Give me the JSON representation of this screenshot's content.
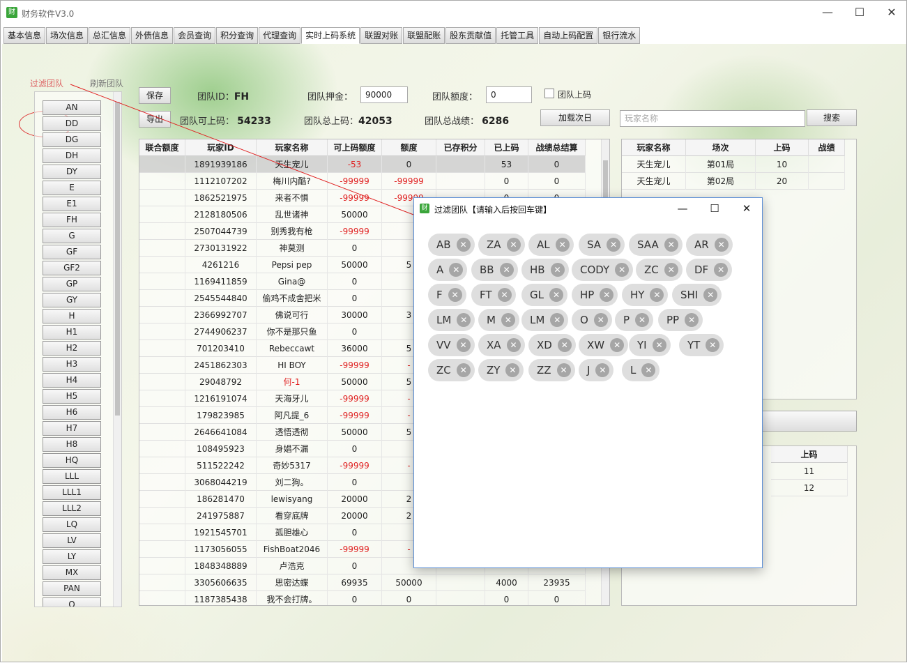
{
  "window": {
    "title": "财务软件V3.0",
    "icon_char": "财",
    "minimize": "—",
    "maximize": "☐",
    "close": "✕"
  },
  "tabs": [
    "基本信息",
    "场次信息",
    "总汇信息",
    "外债信息",
    "会员查询",
    "积分查询",
    "代理查询",
    "实时上码系统",
    "联盟对账",
    "联盟配账",
    "股东贡献值",
    "托管工具",
    "自动上码配置",
    "银行流水"
  ],
  "active_tab": "实时上码系统",
  "left": {
    "filter_link": "过滤团队",
    "refresh_link": "刷新团队",
    "teams": [
      "AN",
      "DD",
      "DG",
      "DH",
      "DY",
      "E",
      "E1",
      "FH",
      "G",
      "GF",
      "GF2",
      "GP",
      "GY",
      "H",
      "H1",
      "H2",
      "H3",
      "H4",
      "H5",
      "H6",
      "H7",
      "H8",
      "HQ",
      "LLL",
      "LLL1",
      "LLL2",
      "LQ",
      "LV",
      "LY",
      "MX",
      "PAN",
      "Q"
    ]
  },
  "toolbar": {
    "save_label": "保存",
    "export_label": "导出",
    "team_id_label": "团队ID：",
    "team_id": "FH",
    "deposit_label": "团队押金：",
    "deposit_value": "90000",
    "quota_label": "团队额度：",
    "quota_value": "0",
    "team_upload_label": "团队上码",
    "can_upload_label": "团队可上码：",
    "can_upload": "54233",
    "total_upload_label": "团队总上码：",
    "total_upload": "42053",
    "total_score_label": "团队总战绩：",
    "total_score": "6286",
    "load_next_label": "加载次日",
    "player_search_placeholder": "玩家名称",
    "search_label": "搜索"
  },
  "main_table": {
    "headers": [
      "联合额度",
      "玩家ID",
      "玩家名称",
      "可上码额度",
      "额度",
      "已存积分",
      "已上码",
      "战绩总结算"
    ],
    "rows": [
      [
        "",
        "1891939186",
        "天生宠儿",
        "-53",
        "0",
        "",
        "53",
        "0"
      ],
      [
        "",
        "1112107202",
        "梅川内酷?",
        "-99999",
        "-99999",
        "",
        "0",
        "0"
      ],
      [
        "",
        "1862521975",
        "来者不惧",
        "-99999",
        "-99999",
        "",
        "0",
        "0"
      ],
      [
        "",
        "2128180506",
        "乱世诸神",
        "50000",
        "",
        "",
        "",
        ""
      ],
      [
        "",
        "2507044739",
        "别秀我有枪",
        "-99999",
        "",
        "",
        "",
        ""
      ],
      [
        "",
        "2730131922",
        "神莫测",
        "0",
        "",
        "",
        "",
        ""
      ],
      [
        "",
        "4261216",
        "Pepsi pep",
        "50000",
        "5",
        "",
        "",
        ""
      ],
      [
        "",
        "1169411859",
        "Gina@",
        "0",
        "",
        "",
        "",
        ""
      ],
      [
        "",
        "2545544840",
        "偷鸡不成舍把米",
        "0",
        "",
        "",
        "",
        ""
      ],
      [
        "",
        "2366992707",
        "佛说可行",
        "30000",
        "3",
        "",
        "",
        ""
      ],
      [
        "",
        "2744906237",
        "你不是那只鱼",
        "0",
        "",
        "",
        "",
        ""
      ],
      [
        "",
        "701203410",
        "Rebeccawt",
        "36000",
        "5",
        "",
        "",
        ""
      ],
      [
        "",
        "2451862303",
        "HI BOY",
        "-99999",
        "-",
        "",
        "",
        ""
      ],
      [
        "",
        "29048792",
        "何-1",
        "50000",
        "5",
        "",
        "",
        ""
      ],
      [
        "",
        "1216191074",
        "天海牙儿",
        "-99999",
        "-",
        "",
        "",
        ""
      ],
      [
        "",
        "179823985",
        "阿凡提_6",
        "-99999",
        "-",
        "",
        "",
        ""
      ],
      [
        "",
        "2646641084",
        "透悟透彻",
        "50000",
        "5",
        "",
        "",
        ""
      ],
      [
        "",
        "108495923",
        "身娼不漏",
        "0",
        "",
        "",
        "",
        ""
      ],
      [
        "",
        "511522242",
        "奇妙5317",
        "-99999",
        "-",
        "",
        "",
        ""
      ],
      [
        "",
        "3068044219",
        "刘二狗。",
        "0",
        "",
        "",
        "",
        ""
      ],
      [
        "",
        "186281470",
        "lewisyang",
        "20000",
        "2",
        "",
        "",
        ""
      ],
      [
        "",
        "241975887",
        "看穿底牌",
        "20000",
        "2",
        "",
        "",
        ""
      ],
      [
        "",
        "1921545701",
        "孤胆雄心",
        "0",
        "",
        "",
        "",
        ""
      ],
      [
        "",
        "1173056055",
        "FishBoat2046",
        "-99999",
        "-",
        "",
        "",
        ""
      ],
      [
        "",
        "1848348889",
        "卢浩克",
        "0",
        "",
        "",
        "",
        ""
      ],
      [
        "",
        "3305606635",
        "思密达蝶",
        "69935",
        "50000",
        "",
        "4000",
        "23935"
      ],
      [
        "",
        "1187385438",
        "我不会打牌。",
        "0",
        "0",
        "",
        "0",
        "0"
      ]
    ],
    "red_names": [
      "何-1"
    ]
  },
  "right_table": {
    "headers": [
      "玩家名称",
      "场次",
      "上码",
      "战绩"
    ],
    "rows": [
      [
        "天生宠儿",
        "第01局",
        "10",
        ""
      ],
      [
        "天生宠儿",
        "第02局",
        "20",
        ""
      ]
    ]
  },
  "right_lower_table": {
    "headers": [
      "上码"
    ],
    "rows": [
      [
        "11"
      ],
      [
        "12"
      ]
    ]
  },
  "dialog": {
    "title": "过滤团队【请输入后按回车键】",
    "icon_char": "财",
    "minimize": "—",
    "maximize": "☐",
    "close": "✕",
    "chips": [
      [
        "AB",
        "ZA",
        "AL",
        "SA",
        "SAA",
        "AR"
      ],
      [
        "A",
        "BB",
        "HB",
        "CODY",
        "ZC",
        "DF"
      ],
      [
        "F",
        "FT",
        "GL",
        "HP",
        "HY",
        "SHI"
      ],
      [
        "LM",
        "M",
        "LM",
        "O",
        "P",
        "PP"
      ],
      [
        "VV",
        "XA",
        "XD",
        "XW",
        "YI",
        "YT"
      ],
      [
        "ZC",
        "ZY",
        "ZZ",
        "J",
        "L"
      ]
    ],
    "remove_icon": "✕"
  }
}
